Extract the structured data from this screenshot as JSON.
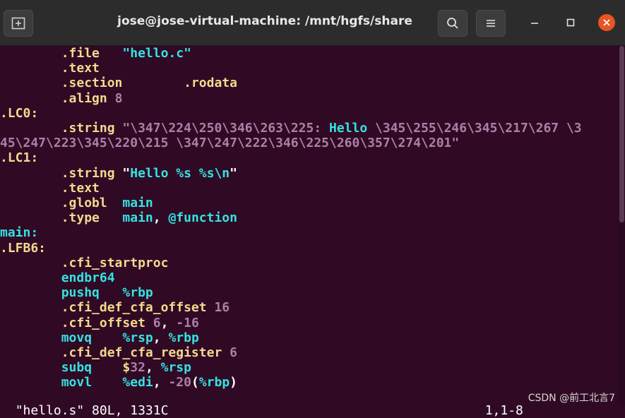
{
  "window": {
    "title": "jose@jose-virtual-machine: /mnt/hgfs/share",
    "accent": "#e95420",
    "background": "#300a24"
  },
  "titlebar_icons": {
    "new_tab": "new-tab-icon",
    "search": "search-icon",
    "menu": "hamburger-menu-icon",
    "minimize": "minimize-icon",
    "maximize": "maximize-icon",
    "close": "close-icon"
  },
  "lines": [
    [
      [
        "        ",
        "s"
      ],
      [
        ".file   ",
        "y"
      ],
      [
        "\"hello.c\"",
        "b"
      ]
    ],
    [
      [
        "        ",
        "s"
      ],
      [
        ".text",
        "y"
      ]
    ],
    [
      [
        "        ",
        "s"
      ],
      [
        ".section        ",
        "y"
      ],
      [
        ".rodata",
        "y"
      ]
    ],
    [
      [
        "        ",
        "s"
      ],
      [
        ".align ",
        "y"
      ],
      [
        "8",
        "d"
      ]
    ],
    [
      [
        ".LC0:",
        "y"
      ]
    ],
    [
      [
        "        ",
        "s"
      ],
      [
        ".string ",
        "y"
      ],
      [
        "\"\\347\\224\\250\\346\\263\\225: ",
        "d"
      ],
      [
        "Hello ",
        "b"
      ],
      [
        "\\345\\255\\246\\345\\217\\267 \\3",
        "d"
      ]
    ],
    [
      [
        "45\\247\\223\\345\\220\\215 \\347\\247\\222\\346\\225\\260\\357\\274\\201\"",
        "d"
      ]
    ],
    [
      [
        ".LC1:",
        "y"
      ]
    ],
    [
      [
        "        ",
        "s"
      ],
      [
        ".string ",
        "y"
      ],
      [
        "\"",
        "w"
      ],
      [
        "Hello %s %s",
        "b"
      ],
      [
        "\\n",
        "b"
      ],
      [
        "\"",
        "w"
      ]
    ],
    [
      [
        "        ",
        "s"
      ],
      [
        ".text",
        "y"
      ]
    ],
    [
      [
        "        ",
        "s"
      ],
      [
        ".globl  ",
        "y"
      ],
      [
        "main",
        "b"
      ]
    ],
    [
      [
        "        ",
        "s"
      ],
      [
        ".type   ",
        "y"
      ],
      [
        "main",
        "b"
      ],
      [
        ", ",
        "w"
      ],
      [
        "@function",
        "b"
      ]
    ],
    [
      [
        "main:",
        "b"
      ]
    ],
    [
      [
        ".LFB6:",
        "y"
      ]
    ],
    [
      [
        "        ",
        "s"
      ],
      [
        ".cfi_startproc",
        "y"
      ]
    ],
    [
      [
        "        ",
        "s"
      ],
      [
        "endbr64",
        "b"
      ]
    ],
    [
      [
        "        ",
        "s"
      ],
      [
        "pushq   ",
        "b"
      ],
      [
        "%rbp",
        "b"
      ]
    ],
    [
      [
        "        ",
        "s"
      ],
      [
        ".cfi_def_cfa_offset ",
        "y"
      ],
      [
        "16",
        "d"
      ]
    ],
    [
      [
        "        ",
        "s"
      ],
      [
        ".cfi_offset ",
        "y"
      ],
      [
        "6",
        "d"
      ],
      [
        ", ",
        "w"
      ],
      [
        "-16",
        "d"
      ]
    ],
    [
      [
        "        ",
        "s"
      ],
      [
        "movq    ",
        "b"
      ],
      [
        "%rsp",
        "b"
      ],
      [
        ", ",
        "w"
      ],
      [
        "%rbp",
        "b"
      ]
    ],
    [
      [
        "        ",
        "s"
      ],
      [
        ".cfi_def_cfa_register ",
        "y"
      ],
      [
        "6",
        "d"
      ]
    ],
    [
      [
        "        ",
        "s"
      ],
      [
        "subq    ",
        "b"
      ],
      [
        "$",
        "y"
      ],
      [
        "32",
        "d"
      ],
      [
        ", ",
        "w"
      ],
      [
        "%rsp",
        "b"
      ]
    ],
    [
      [
        "        ",
        "s"
      ],
      [
        "movl    ",
        "b"
      ],
      [
        "%edi",
        "b"
      ],
      [
        ", ",
        "w"
      ],
      [
        "-20",
        "d"
      ],
      [
        "(",
        "w"
      ],
      [
        "%rbp",
        "b"
      ],
      [
        ")",
        "w"
      ]
    ]
  ],
  "status_line": {
    "file": "\"hello.s\" 80L, 1331C",
    "position": "1,1-8"
  },
  "watermark": "CSDN @前工北言7"
}
